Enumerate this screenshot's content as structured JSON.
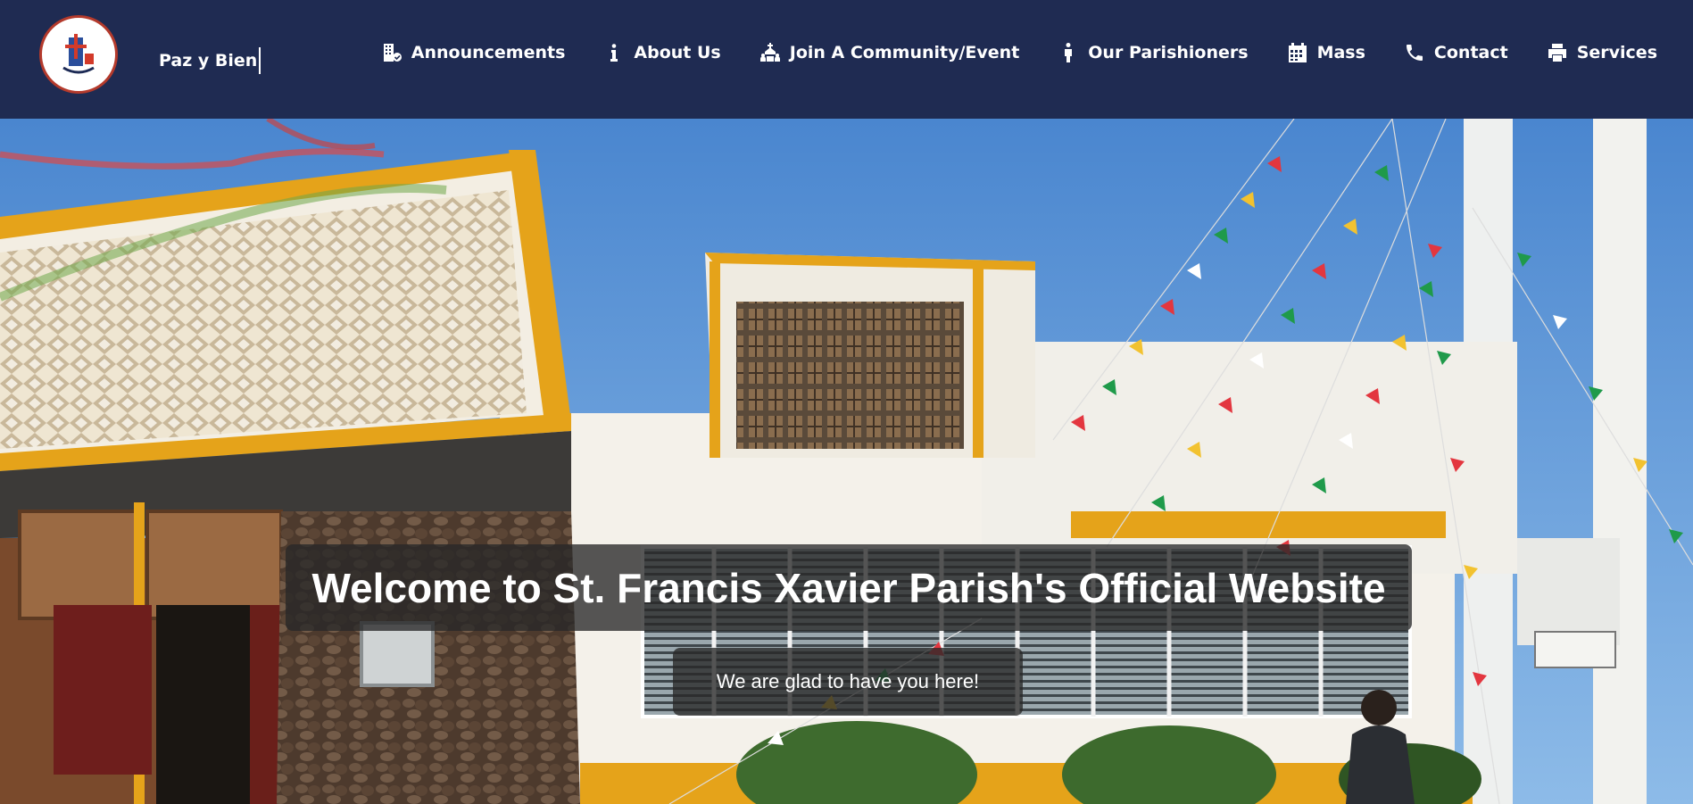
{
  "header": {
    "tagline": "Paz y Bien",
    "nav": [
      {
        "label": "Announcements",
        "icon": "building-check-icon"
      },
      {
        "label": "About Us",
        "icon": "info-icon"
      },
      {
        "label": "Join A Community/Event",
        "icon": "people-church-icon"
      },
      {
        "label": "Our Parishioners",
        "icon": "person-icon"
      },
      {
        "label": "Mass",
        "icon": "calendar-icon"
      },
      {
        "label": "Contact",
        "icon": "phone-icon"
      },
      {
        "label": "Services",
        "icon": "printer-icon"
      }
    ]
  },
  "hero": {
    "title": "Welcome to St. Francis Xavier Parish's Official Website",
    "subtitle": "We are glad to have you here!"
  },
  "colors": {
    "navbar": "#1f2b52",
    "accent": "#e5a31a",
    "overlay": "#282828"
  }
}
